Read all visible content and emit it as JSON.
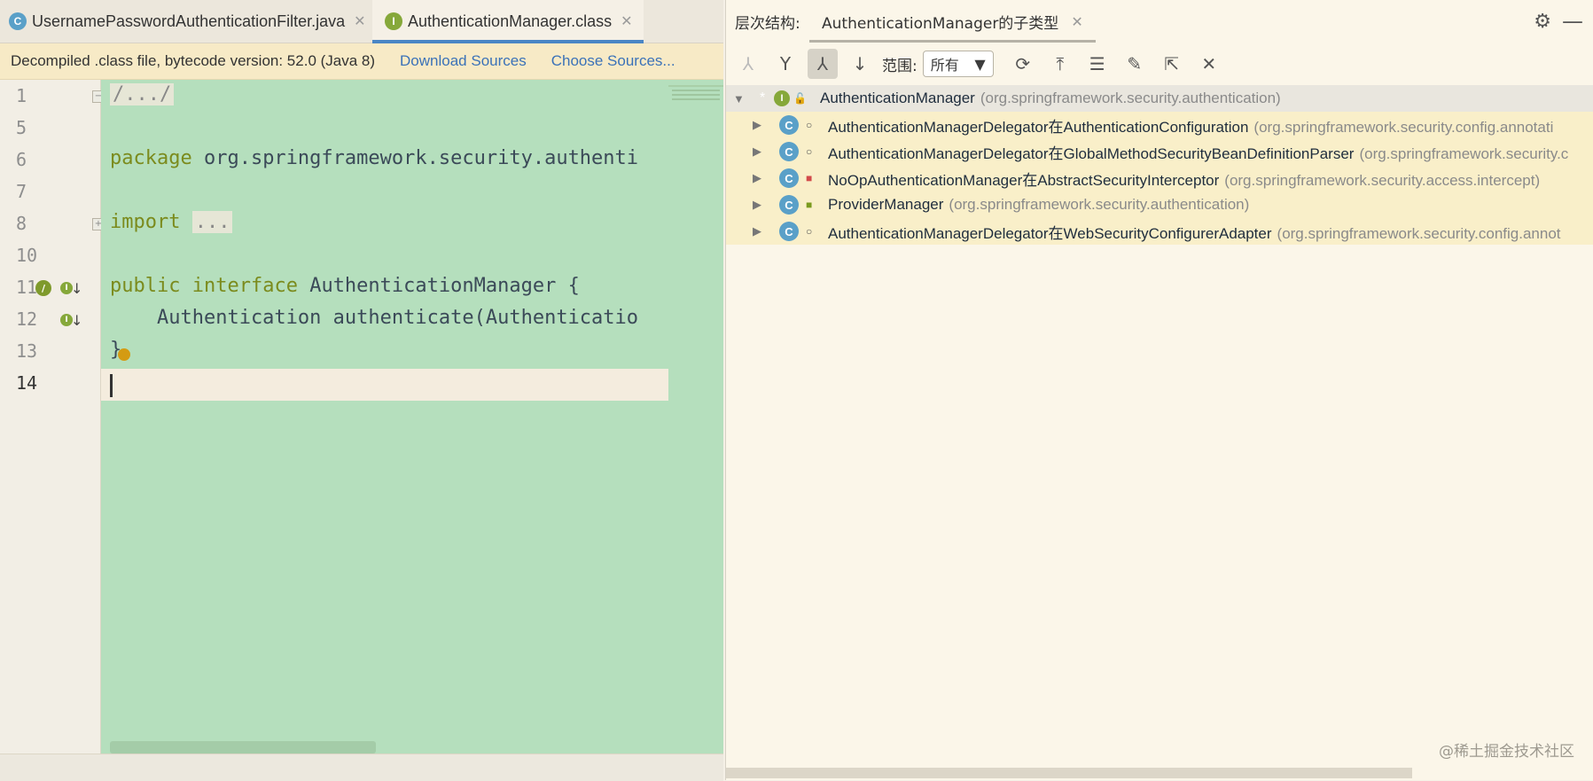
{
  "editor": {
    "tabs": [
      {
        "icon": "C",
        "label": "UsernamePasswordAuthenticationFilter.java",
        "close": "✕"
      },
      {
        "icon": "I",
        "label": "AuthenticationManager.class",
        "close": "✕"
      }
    ],
    "banner": {
      "message": "Decompiled .class file, bytecode version: 52.0 (Java 8)",
      "download_sources": "Download Sources",
      "choose_sources": "Choose Sources..."
    },
    "line_numbers": [
      "1",
      "5",
      "6",
      "7",
      "8",
      "10",
      "11",
      "12",
      "13",
      "14"
    ],
    "code": {
      "line1": "/.../",
      "line6_kw": "package",
      "line6_rest": " org.springframework.security.authenti",
      "line8_kw": "import",
      "line8_fold": "...",
      "line11_kw1": "public",
      "line11_kw2": "interface",
      "line11_rest": " AuthenticationManager {",
      "line12": "    Authentication authenticate(Authenticatio",
      "line13": "}"
    }
  },
  "hierarchy": {
    "panel_title": "层次结构:",
    "tab_label": "AuthenticationManager的子类型",
    "tab_close": "✕",
    "scope_label": "范围:",
    "scope_value": "所有",
    "root": {
      "icon": "I",
      "name": "AuthenticationManager",
      "package": "(org.springframework.security.authentication)"
    },
    "children": [
      {
        "icon": "C",
        "name": "AuthenticationManagerDelegator在AuthenticationConfiguration",
        "package": "(org.springframework.security.config.annotati"
      },
      {
        "icon": "C",
        "name": "AuthenticationManagerDelegator在GlobalMethodSecurityBeanDefinitionParser",
        "package": "(org.springframework.security.c"
      },
      {
        "icon": "C",
        "name": "NoOpAuthenticationManager在AbstractSecurityInterceptor",
        "package": "(org.springframework.security.access.intercept)"
      },
      {
        "icon": "C",
        "name": "ProviderManager",
        "package": "(org.springframework.security.authentication)"
      },
      {
        "icon": "C",
        "name": "AuthenticationManagerDelegator在WebSecurityConfigurerAdapter",
        "package": "(org.springframework.security.config.annot"
      }
    ]
  },
  "watermark": "@稀土掘金技术社区"
}
